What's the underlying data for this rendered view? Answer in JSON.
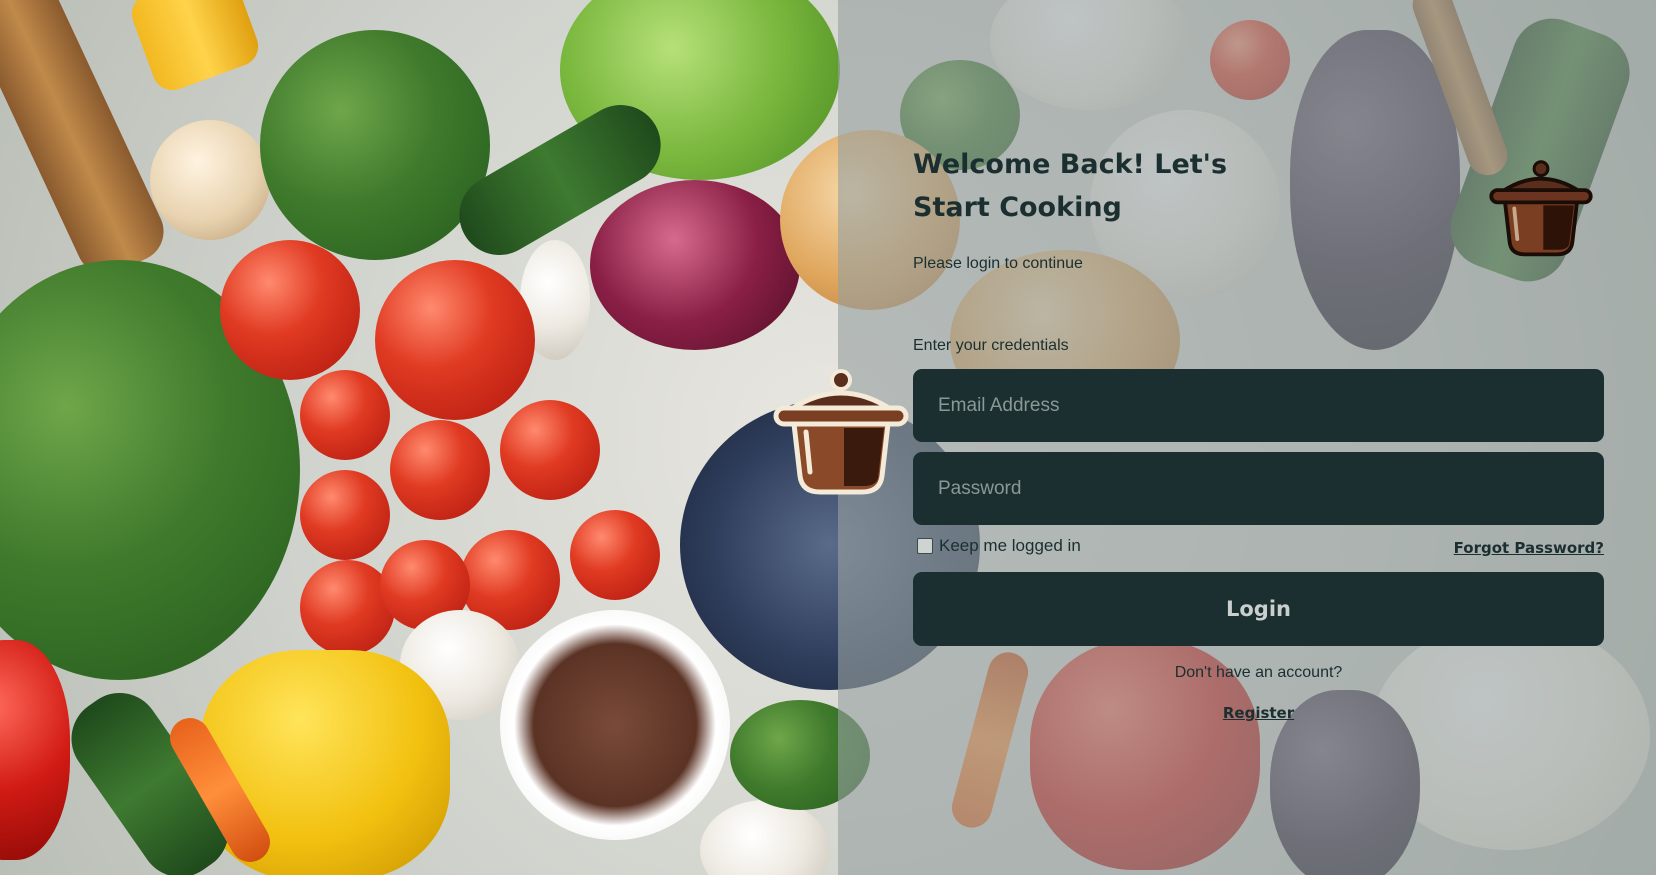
{
  "header": {
    "title": "Welcome Back! Let's Start Cooking",
    "subtitle": "Please login to continue"
  },
  "form": {
    "credentials_label": "Enter your credentials",
    "email_placeholder": "Email Address",
    "password_placeholder": "Password",
    "keep_logged_in_label": "Keep me logged in",
    "forgot_password_label": "Forgot Password?",
    "login_label": "Login"
  },
  "footer": {
    "no_account_text": "Don't have an account?",
    "register_label": "Register"
  },
  "icons": {
    "logo": "cooking-pot-icon",
    "background": "vegetables-background-image"
  },
  "colors": {
    "primary_dark": "#1b2f30",
    "pot_brown": "#5a2e1c"
  }
}
